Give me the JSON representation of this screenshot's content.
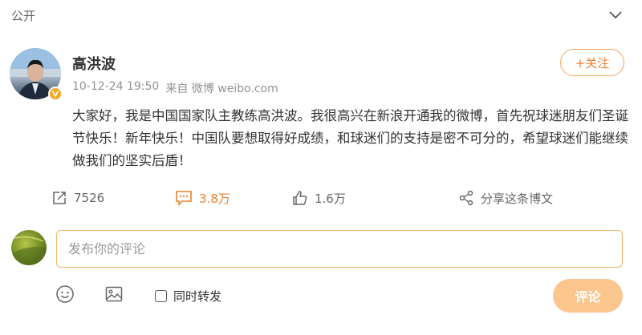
{
  "header": {
    "visibility": "公开",
    "collapse_icon": "chevron-down-icon"
  },
  "post": {
    "author": "高洪波",
    "timestamp": "10-12-24 19:50",
    "source": "来自 微博 weibo.com",
    "follow_label": "+关注",
    "text": "大家好，我是中国国家队主教练高洪波。我很高兴在新浪开通我的微博，首先祝球迷朋友们圣诞节快乐！新年快乐！中国队要想取得好成绩，和球迷们的支持是密不可分的，希望球迷们能继续做我们的坚实后盾！"
  },
  "actions": {
    "repost_count": "7526",
    "comment_count": "3.8万",
    "like_count": "1.6万",
    "share_label": "分享这条博文"
  },
  "comment_box": {
    "placeholder": "发布你的评论",
    "repost_label": "同时转发",
    "submit_label": "评论"
  },
  "colors": {
    "accent": "#e8812d",
    "submit_bg": "#fbc58e",
    "input_border": "#f0b46a",
    "verify_badge": "#f5a623"
  }
}
